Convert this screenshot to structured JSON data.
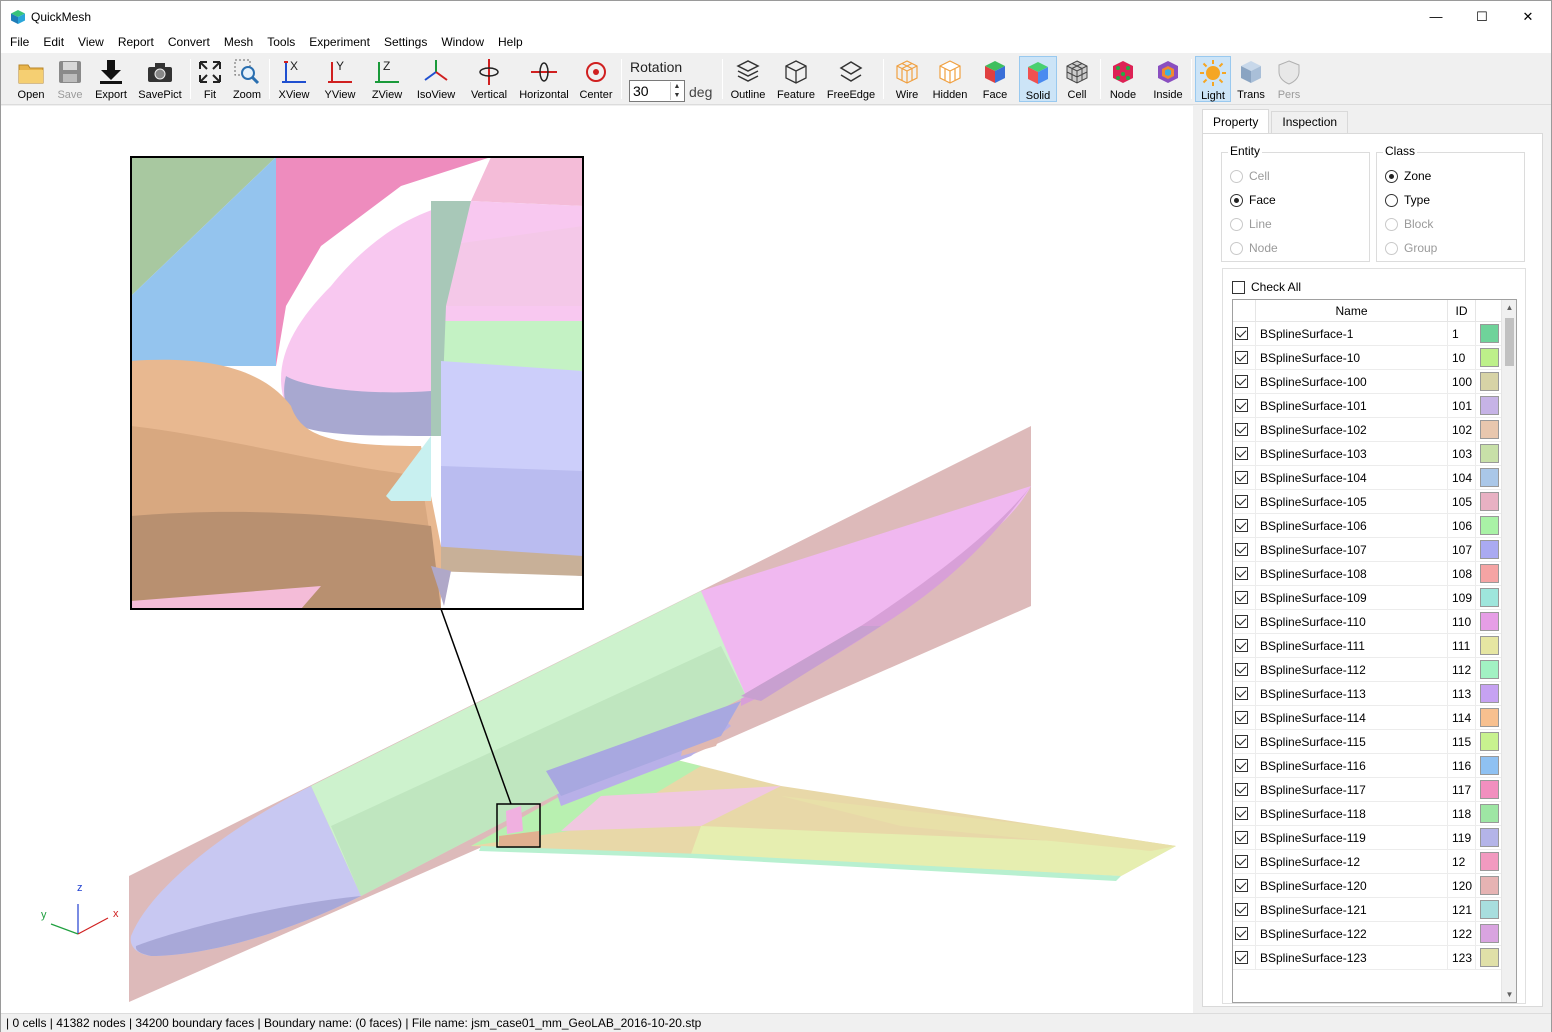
{
  "window": {
    "title": "QuickMesh",
    "minimize": "—",
    "maximize": "☐",
    "close": "✕"
  },
  "menu": [
    "File",
    "Edit",
    "View",
    "Report",
    "Convert",
    "Mesh",
    "Tools",
    "Experiment",
    "Settings",
    "Window",
    "Help"
  ],
  "toolbar": {
    "open": "Open",
    "save": "Save",
    "export": "Export",
    "savepict": "SavePict",
    "fit": "Fit",
    "zoom": "Zoom",
    "xview": "XView",
    "yview": "YView",
    "zview": "ZView",
    "isoview": "IsoView",
    "vertical": "Vertical",
    "horizontal": "Horizontal",
    "center": "Center",
    "rotation_label": "Rotation",
    "rotation_value": "30",
    "rotation_unit": "deg",
    "outline": "Outline",
    "feature": "Feature",
    "freeedge": "FreeEdge",
    "wire": "Wire",
    "hidden": "Hidden",
    "face": "Face",
    "solid": "Solid",
    "cell": "Cell",
    "node": "Node",
    "inside": "Inside",
    "light": "Light",
    "trans": "Trans",
    "pers": "Pers"
  },
  "axes": {
    "x": "x",
    "y": "y",
    "z": "z"
  },
  "panel": {
    "tabs": [
      "Property",
      "Inspection"
    ],
    "entity": {
      "title": "Entity",
      "options": [
        "Cell",
        "Face",
        "Line",
        "Node"
      ],
      "selected": "Face"
    },
    "class": {
      "title": "Class",
      "options": [
        "Zone",
        "Type",
        "Block",
        "Group"
      ],
      "selected": "Zone"
    },
    "check_all": "Check All",
    "columns": {
      "name": "Name",
      "id": "ID"
    },
    "rows": [
      {
        "name": "BSplineSurface-1",
        "id": "1",
        "color": "#6fd39a"
      },
      {
        "name": "BSplineSurface-10",
        "id": "10",
        "color": "#bdf08a"
      },
      {
        "name": "BSplineSurface-100",
        "id": "100",
        "color": "#d7d3a6"
      },
      {
        "name": "BSplineSurface-101",
        "id": "101",
        "color": "#c6b3e6"
      },
      {
        "name": "BSplineSurface-102",
        "id": "102",
        "color": "#e8c7ae"
      },
      {
        "name": "BSplineSurface-103",
        "id": "103",
        "color": "#c8e0a8"
      },
      {
        "name": "BSplineSurface-104",
        "id": "104",
        "color": "#aac7e8"
      },
      {
        "name": "BSplineSurface-105",
        "id": "105",
        "color": "#e8b1c3"
      },
      {
        "name": "BSplineSurface-106",
        "id": "106",
        "color": "#a9f2a6"
      },
      {
        "name": "BSplineSurface-107",
        "id": "107",
        "color": "#aaaaf2"
      },
      {
        "name": "BSplineSurface-108",
        "id": "108",
        "color": "#f5a4a4"
      },
      {
        "name": "BSplineSurface-109",
        "id": "109",
        "color": "#9ee6dc"
      },
      {
        "name": "BSplineSurface-110",
        "id": "110",
        "color": "#e69ee6"
      },
      {
        "name": "BSplineSurface-111",
        "id": "111",
        "color": "#e6e6a2"
      },
      {
        "name": "BSplineSurface-112",
        "id": "112",
        "color": "#a2f2c3"
      },
      {
        "name": "BSplineSurface-113",
        "id": "113",
        "color": "#c6a2f2"
      },
      {
        "name": "BSplineSurface-114",
        "id": "114",
        "color": "#f7c08f"
      },
      {
        "name": "BSplineSurface-115",
        "id": "115",
        "color": "#c8f28f"
      },
      {
        "name": "BSplineSurface-116",
        "id": "116",
        "color": "#8fc1f2"
      },
      {
        "name": "BSplineSurface-117",
        "id": "117",
        "color": "#f28fbf"
      },
      {
        "name": "BSplineSurface-118",
        "id": "118",
        "color": "#9ee6a4"
      },
      {
        "name": "BSplineSurface-119",
        "id": "119",
        "color": "#b4b4e8"
      },
      {
        "name": "BSplineSurface-12",
        "id": "12",
        "color": "#f29ac0"
      },
      {
        "name": "BSplineSurface-120",
        "id": "120",
        "color": "#e6b3b3"
      },
      {
        "name": "BSplineSurface-121",
        "id": "121",
        "color": "#a8dede"
      },
      {
        "name": "BSplineSurface-122",
        "id": "122",
        "color": "#d9a4e0"
      },
      {
        "name": "BSplineSurface-123",
        "id": "123",
        "color": "#e0e0a8"
      }
    ]
  },
  "status": "| 0 cells | 41382 nodes | 34200 boundary faces |  Boundary name:  (0 faces) | File name: jsm_case01_mm_GeoLAB_2016-10-20.stp"
}
